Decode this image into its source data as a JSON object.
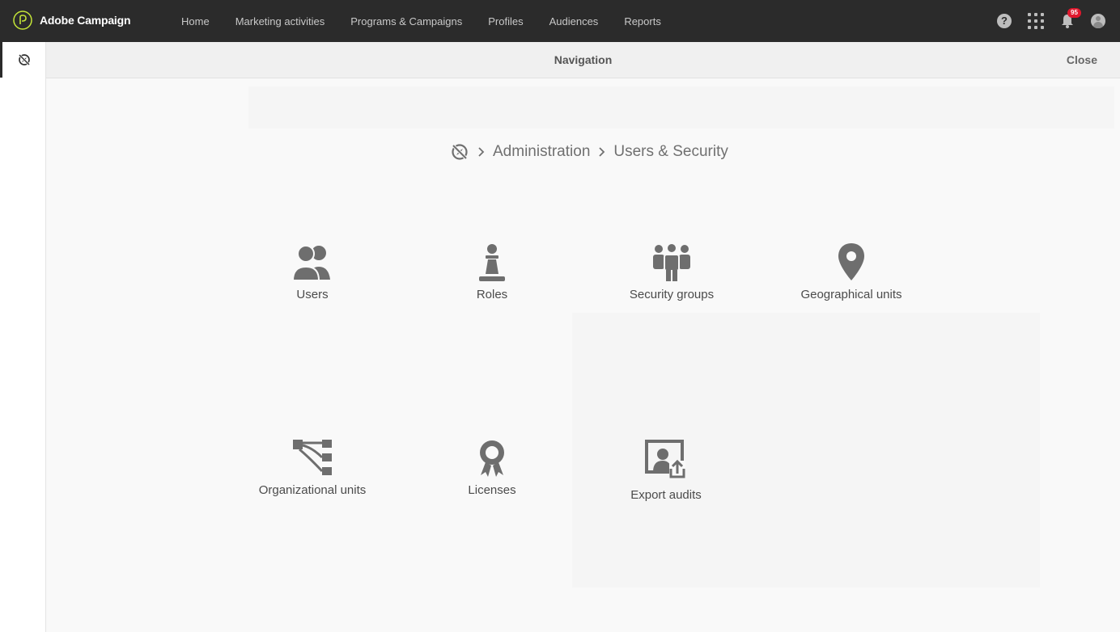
{
  "app": {
    "name": "Adobe Campaign",
    "brand_color": "#c4e538"
  },
  "topnav": {
    "items": [
      {
        "label": "Home"
      },
      {
        "label": "Marketing activities"
      },
      {
        "label": "Programs & Campaigns"
      },
      {
        "label": "Profiles"
      },
      {
        "label": "Audiences"
      },
      {
        "label": "Reports"
      }
    ]
  },
  "header_icons": {
    "help": "?",
    "apps": "apps-grid-icon",
    "notifications_count": "95",
    "avatar": "user-avatar-icon"
  },
  "panel": {
    "title": "Navigation",
    "close_label": "Close"
  },
  "breadcrumb": {
    "root_icon": "compass-off-icon",
    "items": [
      {
        "label": "Administration"
      },
      {
        "label": "Users & Security"
      }
    ]
  },
  "tiles": [
    {
      "label": "Users",
      "icon": "users-icon"
    },
    {
      "label": "Roles",
      "icon": "pawn-icon"
    },
    {
      "label": "Security groups",
      "icon": "group-icon"
    },
    {
      "label": "Geographical units",
      "icon": "map-pin-icon"
    },
    {
      "label": "Organizational units",
      "icon": "org-tree-icon"
    },
    {
      "label": "Licenses",
      "icon": "badge-icon"
    },
    {
      "label": "Export audits",
      "icon": "export-audit-icon"
    }
  ],
  "colors": {
    "topbar": "#2b2b2b",
    "icon_gray": "#6e6e6e",
    "badge_red": "#e0182d"
  }
}
